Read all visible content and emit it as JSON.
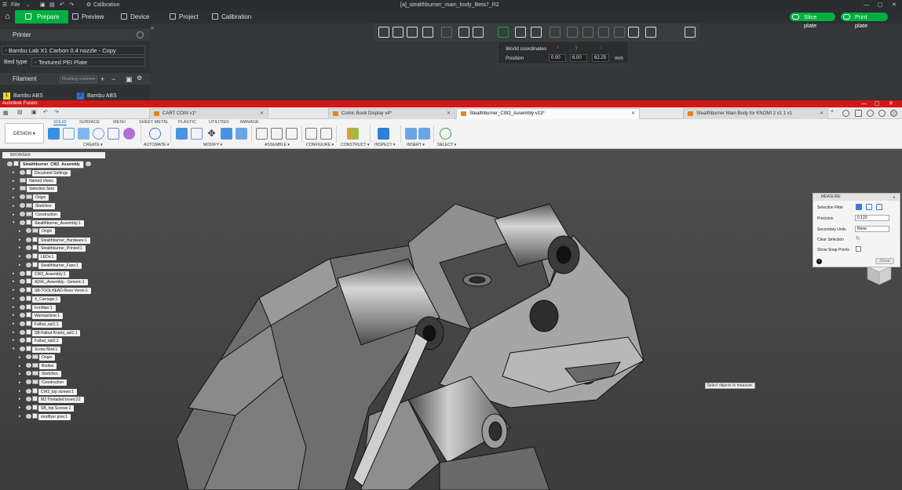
{
  "bambu": {
    "menu": {
      "file": "File",
      "calibration_chip": "Calibration"
    },
    "window_title": "[a]_stealthburner_main_body_Beta7_R2",
    "nav": {
      "prepare": "Prepare",
      "preview": "Preview",
      "device": "Device",
      "project": "Project",
      "calibration": "Calibration"
    },
    "actions": {
      "slice": "Slice plate",
      "print": "Print plate"
    },
    "printer": {
      "header": "Printer",
      "printer_value": "Bambu Lab X1 Carbon 0.4 nozzle - Copy",
      "bed_label": "Bed type",
      "bed_value": "Textured PEI Plate"
    },
    "filament": {
      "header": "Filament",
      "flush_button": "Flushing volumes",
      "slots": [
        {
          "num": "1",
          "name": "Bambu ABS",
          "color": "#f1d81f"
        },
        {
          "num": "2",
          "name": "Bambu ABS",
          "color": "#2e6fd6"
        }
      ]
    },
    "coords": {
      "label": "World coordinates",
      "position_label": "Position",
      "axis_x": "x",
      "axis_y": "y",
      "axis_z": "z",
      "x": "0.00",
      "y": "6.00",
      "z": "62.25",
      "unit": "mm"
    },
    "accent": "#00ae42"
  },
  "fusion": {
    "app_title": "Autodesk Fusion",
    "tabs": [
      {
        "label": "CART COIN v1*"
      },
      {
        "label": "Comic Book Display v4*"
      },
      {
        "label": "Stealthburner_CW2_Assembly v13*"
      },
      {
        "label": "Stealthburner Main Body for KNOMI 2 v1 1 v1"
      }
    ],
    "ribbon": {
      "workspace": "DESIGN ▾",
      "tabs": [
        "SOLID",
        "SURFACE",
        "MESH",
        "SHEET METAL",
        "PLASTIC",
        "UTILITIES",
        "MANAGE"
      ],
      "groups": [
        "CREATE ▾",
        "AUTOMATE ▾",
        "MODIFY ▾",
        "ASSEMBLE ▾",
        "CONFIGURE ▾",
        "CONSTRUCT ▾",
        "INSPECT ▾",
        "INSERT ▾",
        "SELECT ▾"
      ]
    },
    "browser": {
      "header": "BROWSER",
      "root": "Stealthburner_CW2_Assembly",
      "nodes": [
        "Document Settings",
        "Named Views",
        "Selection Sets",
        "Origin",
        "Sketches",
        "Construction",
        "Stealthburner_Assembly:1",
        "Origin",
        "Stealthburner_Hardware:1",
        "Stealthburner_Printed:1",
        "LEDs:1",
        "Stealthburner_Fans:1",
        "CW2_Assembly:1",
        "ADXL_Assembly - Generic:1",
        "SB-TOOLHEAD-Revo Voron:1",
        "X_Carriage:1",
        "IronMan:1",
        "Warmachine:1",
        "Falbut_opt1:1",
        "SB-Falbut Knomi_opt1:1",
        "Falbut_opt2:1",
        "Screw Mod:1",
        "Origin",
        "Bodies",
        "Sketches",
        "Construction",
        "CW2_top screws:1",
        "M3 Threaded Insert:22",
        "SB_top Screws:1",
        "modifyer pins:1"
      ]
    },
    "measure": {
      "title": "MEASURE",
      "selection_filter": "Selection Filter",
      "precision_label": "Precision",
      "precision_value": "0.123",
      "secondary_label": "Secondary Units",
      "secondary_value": "None",
      "clear_label": "Clear Selection",
      "snap_label": "Show Snap Points",
      "close": "Close"
    },
    "tooltip": "Select objects to measure.",
    "title_color": "#d41616"
  }
}
